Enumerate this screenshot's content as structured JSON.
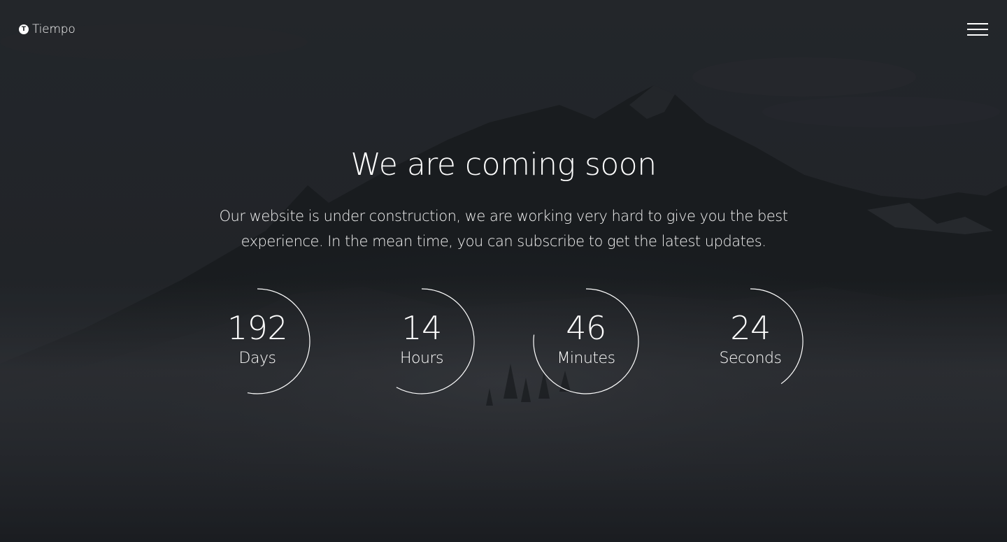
{
  "brand": {
    "logo_letter": "T",
    "name": "Tiempo"
  },
  "header": {
    "menu_icon": "hamburger-menu-icon"
  },
  "hero": {
    "title": "We are coming soon",
    "subtitle": "Our website is under construction, we are working very hard to give you the best experience. In the mean time, you can subscribe to get the latest updates."
  },
  "countdown": {
    "units": [
      {
        "value": "192",
        "label": "Days",
        "progress": 0.53
      },
      {
        "value": "14",
        "label": "Hours",
        "progress": 0.58
      },
      {
        "value": "46",
        "label": "Minutes",
        "progress": 0.77
      },
      {
        "value": "24",
        "label": "Seconds",
        "progress": 0.4
      }
    ]
  },
  "colors": {
    "overlay": "#1f2125",
    "text": "#ffffff",
    "ring": "#ffffff"
  }
}
